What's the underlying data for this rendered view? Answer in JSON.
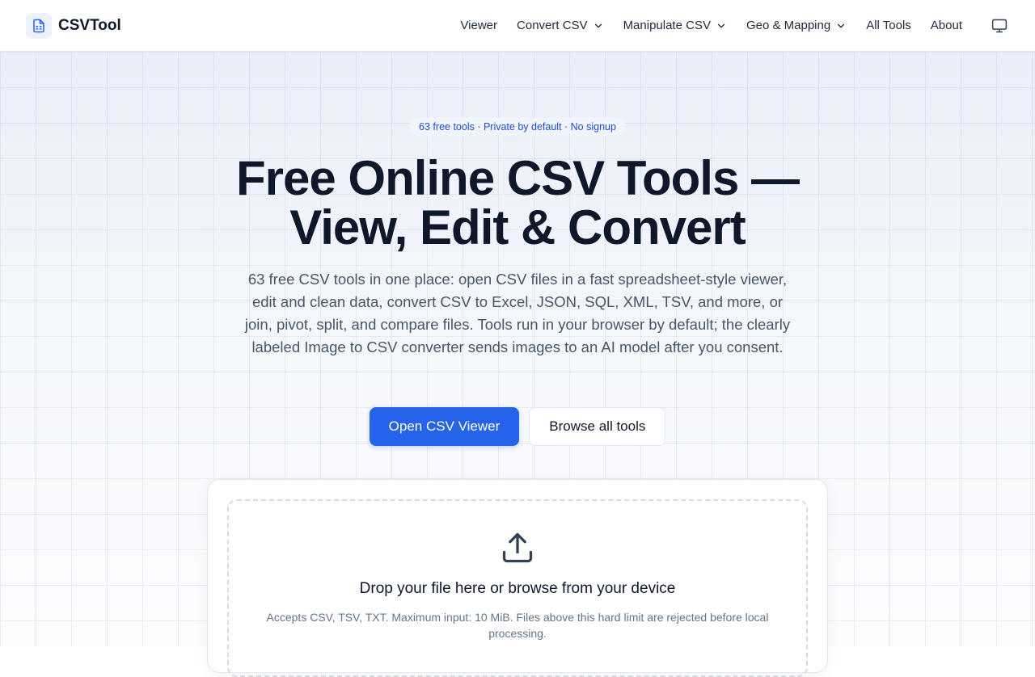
{
  "header": {
    "brand_name": "CSVTool",
    "nav": [
      {
        "label": "Viewer",
        "dropdown": false
      },
      {
        "label": "Convert CSV",
        "dropdown": true
      },
      {
        "label": "Manipulate CSV",
        "dropdown": true
      },
      {
        "label": "Geo & Mapping",
        "dropdown": true
      },
      {
        "label": "All Tools",
        "dropdown": false
      },
      {
        "label": "About",
        "dropdown": false
      }
    ],
    "theme_icon": "monitor-icon"
  },
  "hero": {
    "badge": "63 free tools · Private by default · No signup",
    "title_line1": "Free Online CSV Tools —",
    "title_line2": "View, Edit & Convert",
    "subtitle": "63 free CSV tools in one place: open CSV files in a fast spreadsheet-style viewer, edit and clean data, convert CSV to Excel, JSON, SQL, XML, TSV, and more, or join, pivot, split, and compare files. Tools run in your browser by default; the clearly labeled Image to CSV converter sends images to an AI model after you consent.",
    "primary_button": "Open CSV Viewer",
    "secondary_button": "Browse all tools"
  },
  "upload": {
    "icon": "upload-icon",
    "title": "Drop your file here or browse from your device",
    "help": "Accepts CSV, TSV, TXT. Maximum input: 10 MiB. Files above this hard limit are rejected before local processing."
  },
  "colors": {
    "accent": "#2563eb",
    "text": "#0f172a",
    "muted": "#475569"
  }
}
